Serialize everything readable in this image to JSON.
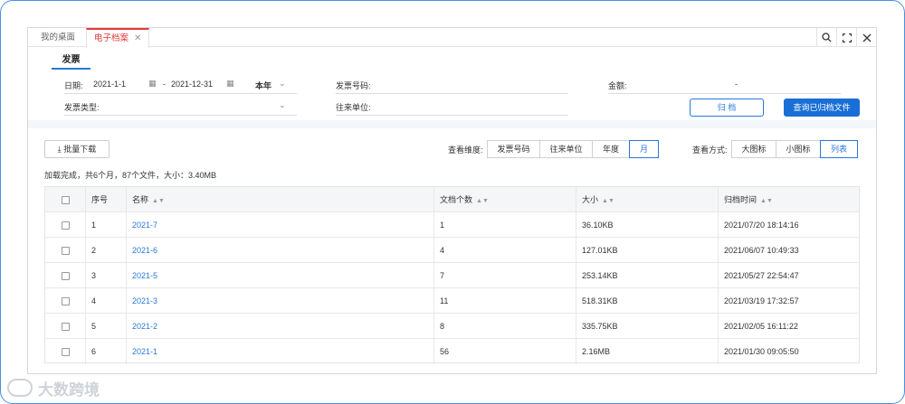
{
  "tabs": [
    {
      "label": "我的桌面"
    },
    {
      "label": "电子档案"
    }
  ],
  "section_tab": "发票",
  "filters": {
    "date_label": "日期:",
    "date_start": "2021-1-1",
    "date_sep": "-",
    "date_end": "2021-12-31",
    "period": "本年",
    "invoice_no_label": "发票号码:",
    "amount_label": "金额:",
    "amount_sep": "-",
    "invoice_type_label": "发票类型:",
    "partner_label": "往来单位:"
  },
  "buttons": {
    "archive": "归 档",
    "query_archived": "查询已归档文件",
    "batch_download": "批量下载"
  },
  "view_dimension": {
    "label": "查看维度:",
    "options": [
      "发票号码",
      "往来单位",
      "年度",
      "月"
    ],
    "selected": "月"
  },
  "view_mode": {
    "label": "查看方式:",
    "options": [
      "大图标",
      "小图标",
      "列表"
    ],
    "selected": "列表"
  },
  "summary": "加载完成，共6个月，87个文件，大小：3.40MB",
  "table": {
    "headers": [
      "序号",
      "名称",
      "文档个数",
      "大小",
      "归档时间"
    ],
    "rows": [
      {
        "no": "1",
        "name": "2021-7",
        "count": "1",
        "size": "36.10KB",
        "time": "2021/07/20 18:14:16"
      },
      {
        "no": "2",
        "name": "2021-6",
        "count": "4",
        "size": "127.01KB",
        "time": "2021/06/07 10:49:33"
      },
      {
        "no": "3",
        "name": "2021-5",
        "count": "7",
        "size": "253.14KB",
        "time": "2021/05/27 22:54:47"
      },
      {
        "no": "4",
        "name": "2021-3",
        "count": "11",
        "size": "518.31KB",
        "time": "2021/03/19 17:32:57"
      },
      {
        "no": "5",
        "name": "2021-2",
        "count": "8",
        "size": "335.75KB",
        "time": "2021/02/05 16:11:22"
      },
      {
        "no": "6",
        "name": "2021-1",
        "count": "56",
        "size": "2.16MB",
        "time": "2021/01/30 09:05:50"
      }
    ]
  },
  "watermark": "大数跨境",
  "colors": {
    "accent": "#2878d8",
    "active_tab": "#e4393c",
    "primary_button": "#1a6fd6"
  }
}
